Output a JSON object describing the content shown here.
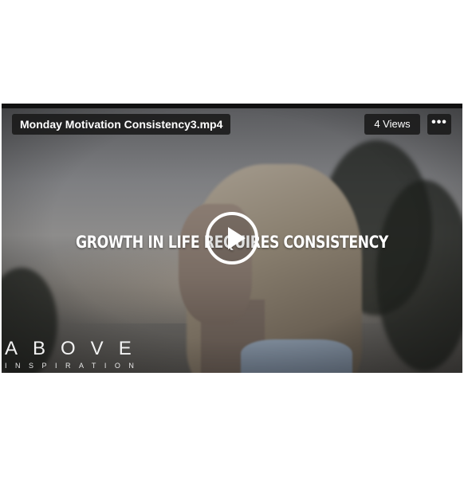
{
  "video": {
    "title": "Monday Motivation Consistency3.mp4",
    "views": "4 Views",
    "more_label": "•••",
    "caption": "GROWTH IN LIFE REQUIRES CONSISTENCY",
    "brand": {
      "name": "ABOVE",
      "tagline": "INSPIRATION"
    }
  },
  "icons": {
    "play": "play-icon",
    "more": "more-options-icon"
  },
  "colors": {
    "overlay_pill": "#191919",
    "text": "#ffffff"
  }
}
